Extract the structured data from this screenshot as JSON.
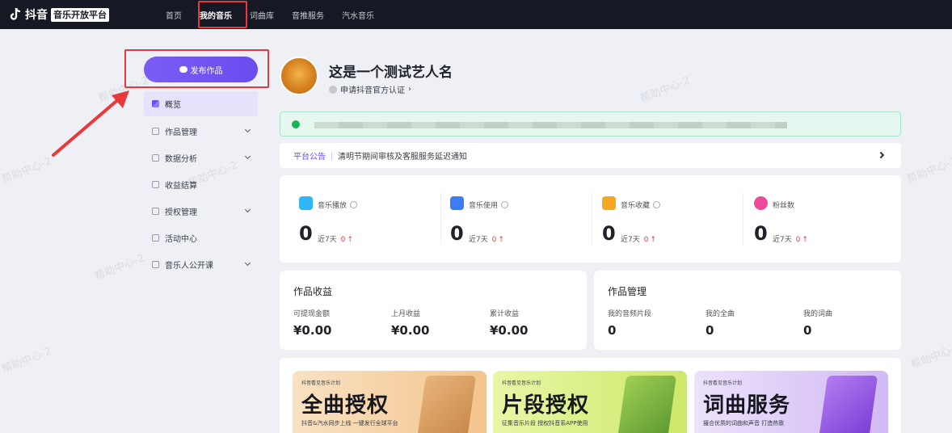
{
  "header": {
    "brand": "抖音",
    "brand_tag": "音乐开放平台",
    "nav": [
      "首页",
      "我的音乐",
      "词曲库",
      "音推服务",
      "汽水音乐"
    ],
    "active_nav": "我的音乐"
  },
  "watermark": "帮助中心-2",
  "sidebar": {
    "publish_label": "发布作品",
    "items": [
      {
        "label": "概览",
        "active": true,
        "icon": "grid-icon"
      },
      {
        "label": "作品管理",
        "expandable": true,
        "icon": "document-icon"
      },
      {
        "label": "数据分析",
        "expandable": true,
        "icon": "bar-chart-icon"
      },
      {
        "label": "收益结算",
        "icon": "wallet-icon"
      },
      {
        "label": "授权管理",
        "expandable": true,
        "icon": "key-icon"
      },
      {
        "label": "活动中心",
        "icon": "calendar-icon"
      },
      {
        "label": "音乐人公开课",
        "expandable": true,
        "icon": "play-icon"
      }
    ]
  },
  "profile": {
    "name": "这是一个测试艺人名",
    "verify_link": "申请抖音官方认证"
  },
  "announcement": {
    "tag": "平台公告",
    "text": "清明节期间审核及客服服务延迟通知"
  },
  "stats": [
    {
      "label": "音乐播放",
      "value": "0",
      "week_label": "近7天",
      "week_value": "0",
      "color": "#2eb6f5"
    },
    {
      "label": "音乐使用",
      "value": "0",
      "week_label": "近7天",
      "week_value": "0",
      "color": "#3d7cf5"
    },
    {
      "label": "音乐收藏",
      "value": "0",
      "week_label": "近7天",
      "week_value": "0",
      "color": "#f5a623"
    },
    {
      "label": "粉丝数",
      "value": "0",
      "week_label": "近7天",
      "week_value": "0",
      "color": "#f0489a"
    }
  ],
  "income": {
    "title": "作品收益",
    "items": [
      {
        "label": "可提现金额",
        "value": "¥0.00"
      },
      {
        "label": "上月收益",
        "value": "¥0.00"
      },
      {
        "label": "累计收益",
        "value": "¥0.00"
      }
    ]
  },
  "works": {
    "title": "作品管理",
    "items": [
      {
        "label": "我的音频片段",
        "value": "0"
      },
      {
        "label": "我的全曲",
        "value": "0"
      },
      {
        "label": "我的词曲",
        "value": "0"
      }
    ]
  },
  "banners": [
    {
      "tag": "抖音看见音乐计划",
      "title": "全曲授权",
      "sub": "抖音&汽水同步上线     一键发行全球平台",
      "bg": "#f6d3a6"
    },
    {
      "tag": "抖音看见音乐计划",
      "title": "片段授权",
      "sub": "征集音乐片段     授权抖音系APP使用",
      "bg": "#d9f080"
    },
    {
      "tag": "抖音看见音乐计划",
      "title": "词曲服务",
      "sub": "撮合优质的词曲和声音     打造热歌",
      "bg": "#dccaf7"
    }
  ]
}
